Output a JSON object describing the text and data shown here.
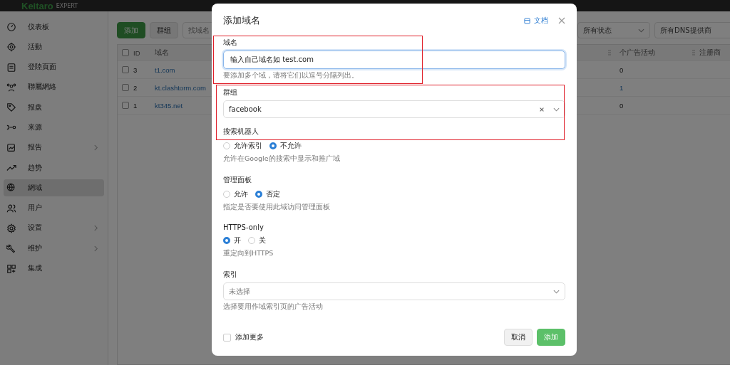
{
  "topbar": {
    "logo": "Keitaro",
    "edition": "EXPERT"
  },
  "sidebar": {
    "items": [
      {
        "label": "仪表板",
        "selected": false,
        "expandable": false
      },
      {
        "label": "活動",
        "selected": false,
        "expandable": false
      },
      {
        "label": "登陸頁面",
        "selected": false,
        "expandable": false
      },
      {
        "label": "聯屬網絡",
        "selected": false,
        "expandable": false
      },
      {
        "label": "报盘",
        "selected": false,
        "expandable": false
      },
      {
        "label": "来源",
        "selected": false,
        "expandable": false
      },
      {
        "label": "报告",
        "selected": false,
        "expandable": true
      },
      {
        "label": "趋势",
        "selected": false,
        "expandable": false
      },
      {
        "label": "網域",
        "selected": true,
        "expandable": false
      },
      {
        "label": "用户",
        "selected": false,
        "expandable": false
      },
      {
        "label": "设置",
        "selected": false,
        "expandable": true
      },
      {
        "label": "维护",
        "selected": false,
        "expandable": true
      },
      {
        "label": "集成",
        "selected": false,
        "expandable": false
      }
    ]
  },
  "toolbar": {
    "add_button": "添加",
    "group_button": "群组",
    "search": {
      "placeholder": "找域名"
    },
    "status_filter": "所有状态",
    "dns_filter": "所有DNS提供商"
  },
  "table": {
    "all_selected": false,
    "columns": [
      "ID",
      "域名",
      "个广告活动",
      "注册商"
    ],
    "rows": [
      {
        "selected": false,
        "id": "3",
        "domain": "t1.com",
        "campaigns": "0",
        "campaigns_link": false
      },
      {
        "selected": false,
        "id": "2",
        "domain": "kt.clashtorm.com",
        "campaigns": "1",
        "campaigns_link": true
      },
      {
        "selected": false,
        "id": "1",
        "domain": "kt345.net",
        "campaigns": "0",
        "campaigns_link": false
      }
    ]
  },
  "dialog": {
    "title": "添加域名",
    "docs_link": "文档",
    "fields": [
      {
        "kind": "input",
        "label": "域名",
        "value": "输入自己域名如 test.com",
        "focused": true,
        "hint": "要添加多个域，请将它们以逗号分隔列出。"
      },
      {
        "kind": "select",
        "label": "群组",
        "value": "facebook",
        "clearable": true
      },
      {
        "kind": "radio",
        "label": "搜索机器人",
        "options": [
          {
            "label": "允许索引",
            "selected": false
          },
          {
            "label": "不允许",
            "selected": true
          }
        ],
        "hint": "允许在Google的搜索中显示和推广域"
      },
      {
        "kind": "radio",
        "label": "管理面板",
        "options": [
          {
            "label": "允许",
            "selected": false
          },
          {
            "label": "否定",
            "selected": true
          }
        ],
        "hint": "指定是否要使用此域访问管理面板"
      },
      {
        "kind": "radio",
        "label": "HTTPS-only",
        "options": [
          {
            "label": "开",
            "selected": true
          },
          {
            "label": "关",
            "selected": false
          }
        ],
        "hint": "重定向到HTTPS"
      },
      {
        "kind": "select",
        "label": "索引",
        "placeholder": "未选择",
        "clearable": false,
        "hint": "选择要用作域索引页的广告活动"
      }
    ],
    "add_more": {
      "label": "添加更多",
      "checked": false
    },
    "cancel_button": "取消",
    "submit_button": "添加"
  }
}
